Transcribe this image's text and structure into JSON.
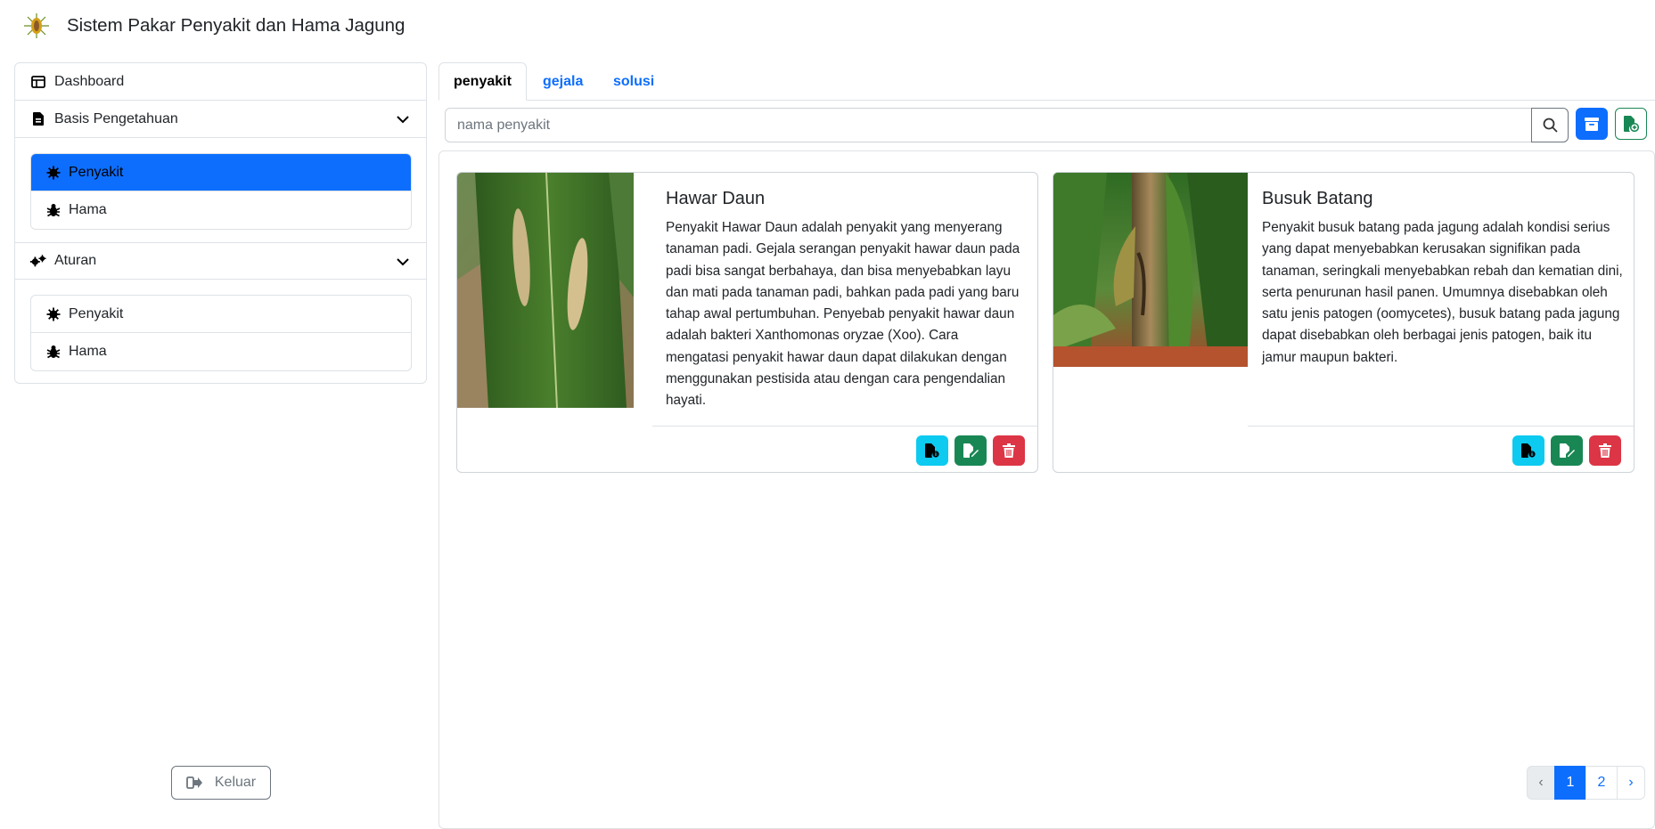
{
  "app": {
    "title": "Sistem Pakar Penyakit dan Hama Jagung"
  },
  "sidebar": {
    "dashboard_label": "Dashboard",
    "basis": {
      "label": "Basis Pengetahuan",
      "items": [
        {
          "label": "Penyakit",
          "icon": "virus-icon",
          "active": true
        },
        {
          "label": "Hama",
          "icon": "bug-icon",
          "active": false
        }
      ]
    },
    "aturan": {
      "label": "Aturan",
      "items": [
        {
          "label": "Penyakit",
          "icon": "virus-icon",
          "active": false
        },
        {
          "label": "Hama",
          "icon": "bug-icon",
          "active": false
        }
      ]
    },
    "logout_label": "Keluar"
  },
  "tabs": [
    {
      "label": "penyakit",
      "active": true
    },
    {
      "label": "gejala",
      "active": false
    },
    {
      "label": "solusi",
      "active": false
    }
  ],
  "search": {
    "placeholder": "nama penyakit"
  },
  "cards": [
    {
      "title": "Hawar Daun",
      "description": "Penyakit Hawar Daun adalah penyakit yang menyerang tanaman padi. Gejala serangan penyakit hawar daun pada padi bisa sangat berbahaya, dan bisa menyebabkan layu dan mati pada tanaman padi, bahkan pada padi yang baru tahap awal pertumbuhan. Penyebab penyakit hawar daun adalah bakteri Xanthomonas oryzae (Xoo). Cara mengatasi penyakit hawar daun dapat dilakukan dengan menggunakan pestisida atau dengan cara pengendalian hayati."
    },
    {
      "title": "Busuk Batang",
      "description": "Penyakit busuk batang pada jagung adalah kondisi serius yang dapat menyebabkan kerusakan signifikan pada tanaman, seringkali menyebabkan rebah dan kematian dini, serta penurunan hasil panen. Umumnya disebabkan oleh satu jenis patogen (oomycetes), busuk batang pada jagung dapat disebabkan oleh berbagai jenis patogen, baik itu jamur maupun bakteri."
    }
  ],
  "pagination": {
    "prev": "‹",
    "pages": [
      "1",
      "2"
    ],
    "current": "1",
    "next": "›"
  },
  "colors": {
    "primary": "#0d6efd",
    "success": "#198754",
    "info": "#0dcaf0",
    "danger": "#dc3545"
  }
}
